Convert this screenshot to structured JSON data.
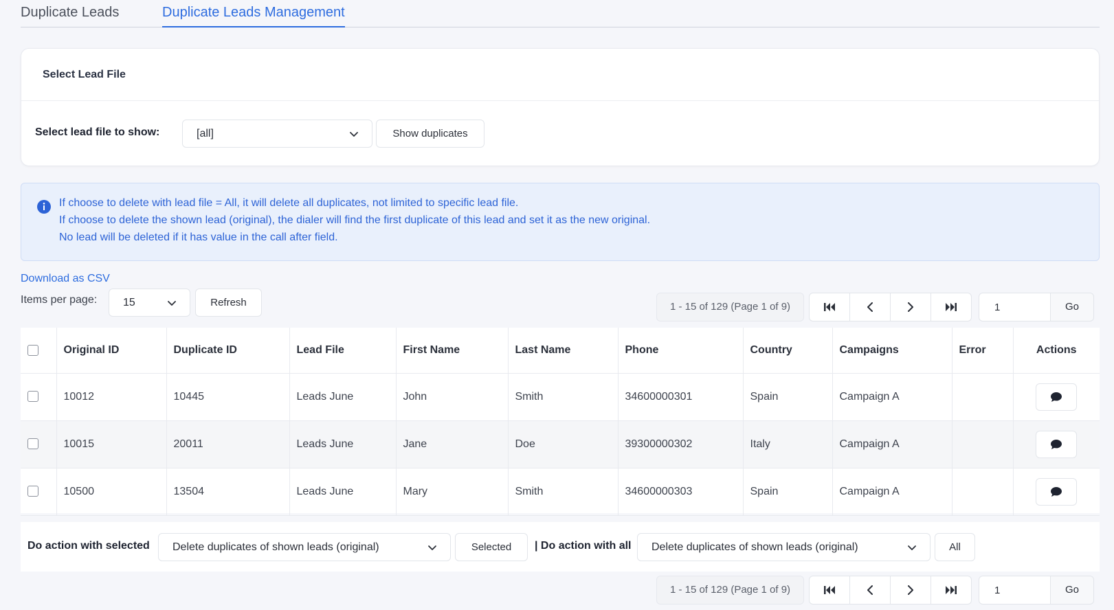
{
  "tabs": [
    {
      "label": "Duplicate Leads"
    },
    {
      "label": "Duplicate Leads Management"
    }
  ],
  "card": {
    "title": "Select Lead File",
    "select_label": "Select lead file to show:",
    "select_value": "[all]",
    "show_button": "Show duplicates"
  },
  "alert": {
    "lines": [
      "If choose to delete with lead file = All, it will delete all duplicates, not limited to specific lead file.",
      "If choose to delete the shown lead (original), the dialer will find the first duplicate of this lead and set it as the new original.",
      "No lead will be deleted if it has value in the call after field."
    ]
  },
  "download_link": "Download as CSV",
  "items_per_page": {
    "label": "Items per page:",
    "value": "15",
    "refresh": "Refresh"
  },
  "pager": {
    "info": "1 - 15 of 129 (Page 1 of 9)",
    "page_input": "1",
    "go": "Go"
  },
  "table": {
    "headers": [
      "Original ID",
      "Duplicate ID",
      "Lead File",
      "First Name",
      "Last Name",
      "Phone",
      "Country",
      "Campaigns",
      "Error",
      "Actions"
    ],
    "rows": [
      [
        "10012",
        "10445",
        "Leads June",
        "John",
        "Smith",
        "34600000301",
        "Spain",
        "Campaign A",
        ""
      ],
      [
        "10015",
        "20011",
        "Leads June",
        "Jane",
        "Doe",
        "39300000302",
        "Italy",
        "Campaign A",
        ""
      ],
      [
        "10500",
        "13504",
        "Leads June",
        "Mary",
        "Smith",
        "34600000303",
        "Spain",
        "Campaign A",
        ""
      ]
    ]
  },
  "action_bar": {
    "selected_label": "Do action with selected",
    "selected_value": "Delete duplicates of shown leads (original)",
    "selected_button": "Selected",
    "all_label": "| Do action with all",
    "all_value": "Delete duplicates of shown leads (original)",
    "all_button": "All"
  },
  "colors": {
    "accent": "#2d6cdf",
    "alert_bg": "#e9f0fc",
    "alert_text": "#2d63d6"
  }
}
